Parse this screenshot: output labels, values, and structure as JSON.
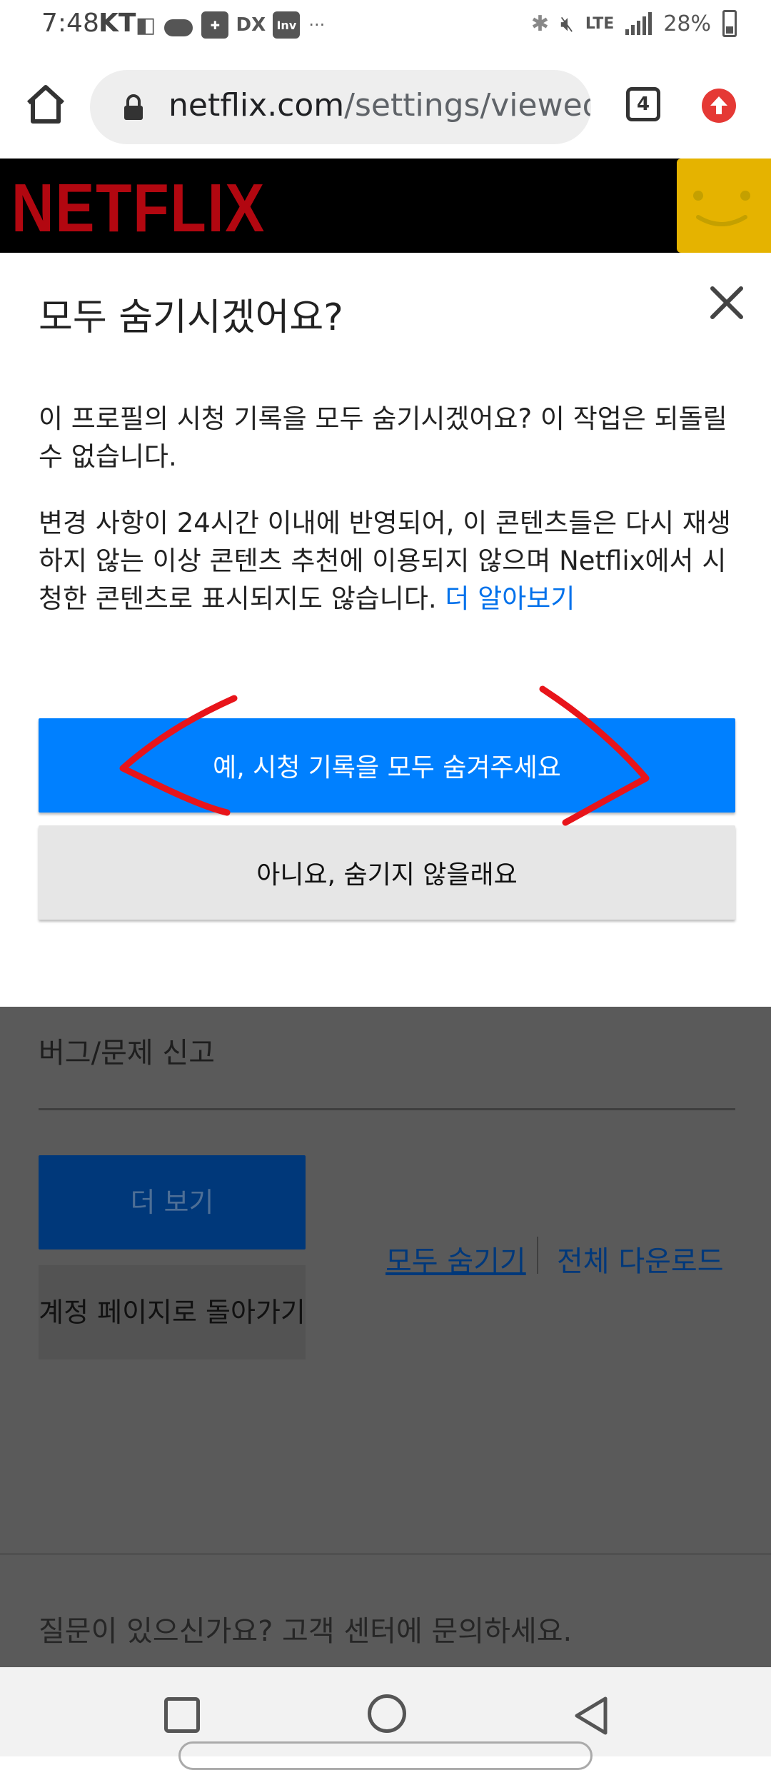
{
  "status_bar": {
    "time": "7:48",
    "carrier": "KT",
    "network": "LTE",
    "battery": "28%",
    "status_icons": [
      "carrier-app-icon",
      "cloud-icon",
      "game-icon",
      "dx-icon",
      "inv-icon",
      "more-dots-icon",
      "bluetooth-icon",
      "mute-icon",
      "signal-icon",
      "battery-icon"
    ],
    "small_icon_labels": {
      "dx": "DX",
      "inv": "Inv",
      "dots": "···"
    }
  },
  "browser": {
    "url_domain": "netflix.com",
    "url_path": "/settings/viewed",
    "tab_count": "4"
  },
  "netflix_header": {
    "logo_text": "NETFLIX"
  },
  "modal": {
    "title": "모두 숨기시겠어요?",
    "paragraph1": "이 프로필의 시청 기록을 모두 숨기시겠어요? 이 작업은 되돌릴 수 없습니다.",
    "paragraph2": "변경 사항이 24시간 이내에 반영되어, 이 콘텐츠들은 다시 재생하지 않는 이상 콘텐츠 추천에 이용되지 않으며 Netflix에서 시청한 콘텐츠로 표시되지도 않습니다.",
    "learn_more_link": "더 알아보기",
    "confirm_button": "예, 시청 기록을 모두 숨겨주세요",
    "cancel_button": "아니요, 숨기지 않을래요"
  },
  "page_behind": {
    "bug_report": "버그/문제 신고",
    "more_button": "더 보기",
    "back_to_account_button": "계정 페이지로 돌아가기",
    "hide_all_link": "모두 숨기기",
    "download_all_link": "전체 다운로드",
    "help_text": "질문이 있으신가요? 고객 센터에 문의하세요."
  },
  "colors": {
    "netflix_red": "#b20710",
    "confirm_blue": "#0080ff",
    "link_blue": "#0071eb",
    "annotation_red": "#e8141a",
    "overlay_gray": "#5a5a5a"
  }
}
